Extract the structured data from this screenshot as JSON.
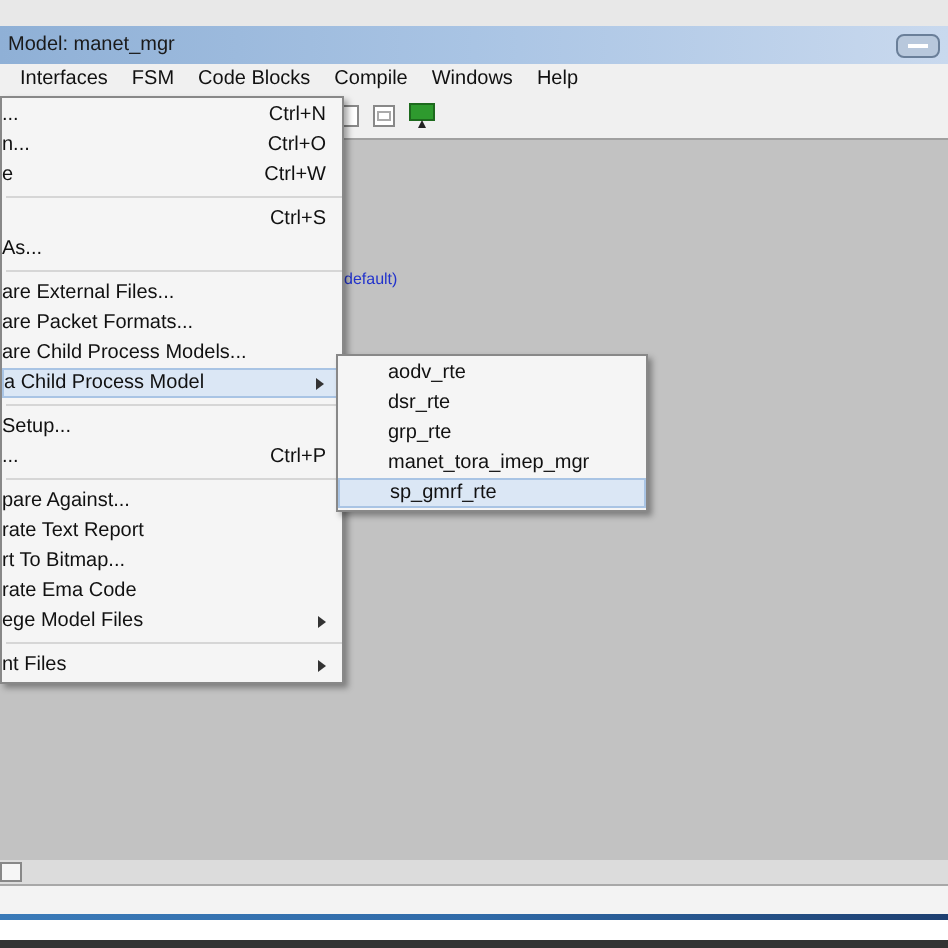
{
  "window": {
    "title": "Model: manet_mgr"
  },
  "menu_bar": [
    {
      "label": "Interfaces",
      "selected": false
    },
    {
      "label": "FSM",
      "selected": false
    },
    {
      "label": "Code Blocks",
      "selected": false
    },
    {
      "label": "Compile",
      "selected": false
    },
    {
      "label": "Windows",
      "selected": false
    },
    {
      "label": "Help",
      "selected": false
    }
  ],
  "canvas": {
    "label": "default)"
  },
  "file_menu": [
    {
      "kind": "item",
      "label": "...",
      "shortcut": "Ctrl+N",
      "submenu": false,
      "selected": false
    },
    {
      "kind": "item",
      "label": "n...",
      "shortcut": "Ctrl+O",
      "submenu": false,
      "selected": false
    },
    {
      "kind": "item",
      "label": "e",
      "shortcut": "Ctrl+W",
      "submenu": false,
      "selected": false
    },
    {
      "kind": "separator"
    },
    {
      "kind": "item",
      "shortcut": "Ctrl+S",
      "submenu": false,
      "selected": false
    },
    {
      "kind": "item",
      "label": "As...",
      "submenu": false,
      "selected": false
    },
    {
      "kind": "separator"
    },
    {
      "kind": "item",
      "label": "are External Files...",
      "submenu": false,
      "selected": false
    },
    {
      "kind": "item",
      "label": "are Packet Formats...",
      "submenu": false,
      "selected": false
    },
    {
      "kind": "item",
      "label": "are Child Process Models...",
      "submenu": false,
      "selected": false
    },
    {
      "kind": "item",
      "label": "a Child Process Model",
      "submenu": true,
      "selected": true
    },
    {
      "kind": "separator"
    },
    {
      "kind": "item",
      "label": "Setup...",
      "submenu": false,
      "selected": false
    },
    {
      "kind": "item",
      "label": "...",
      "shortcut": "Ctrl+P",
      "submenu": false,
      "selected": false
    },
    {
      "kind": "separator"
    },
    {
      "kind": "item",
      "label": "pare Against...",
      "submenu": false,
      "selected": false
    },
    {
      "kind": "item",
      "label": "rate Text Report",
      "submenu": false,
      "selected": false
    },
    {
      "kind": "item",
      "label": "rt To Bitmap...",
      "submenu": false,
      "selected": false
    },
    {
      "kind": "item",
      "label": "rate Ema Code",
      "submenu": false,
      "selected": false
    },
    {
      "kind": "item",
      "label": "ege Model Files",
      "submenu": true,
      "selected": false
    },
    {
      "kind": "separator"
    },
    {
      "kind": "item",
      "label": "nt Files",
      "submenu": true,
      "selected": false
    }
  ],
  "submenu": [
    {
      "label": "aodv_rte",
      "selected": false
    },
    {
      "label": "dsr_rte",
      "selected": false
    },
    {
      "label": "grp_rte",
      "selected": false
    },
    {
      "label": "manet_tora_imep_mgr",
      "selected": false
    },
    {
      "label": "sp_gmrf_rte",
      "selected": true
    }
  ]
}
